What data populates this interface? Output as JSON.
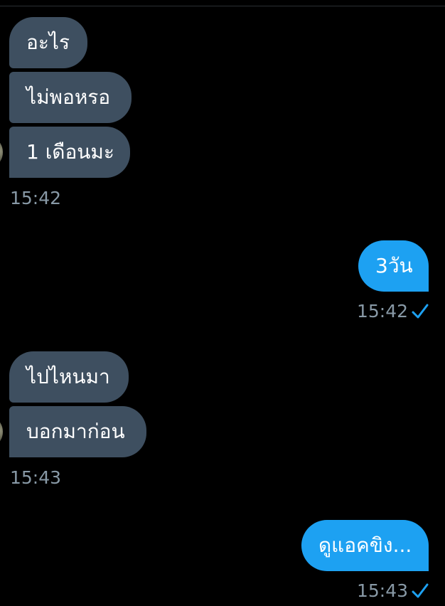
{
  "colors": {
    "background": "#000000",
    "incoming_bubble": "#3e4f60",
    "outgoing_bubble": "#1da1f2",
    "timestamp": "#8899a6",
    "read_check": "#1da1f2"
  },
  "conversation": [
    {
      "direction": "incoming",
      "messages": [
        "อะไร",
        "ไม่พอหรอ",
        "1 เดือนมะ"
      ],
      "time": "15:42"
    },
    {
      "direction": "outgoing",
      "messages": [
        "3วัน"
      ],
      "time": "15:42",
      "status_icon": "check-icon"
    },
    {
      "direction": "incoming",
      "messages": [
        "ไปไหนมา",
        "บอกมาก่อน"
      ],
      "time": "15:43"
    },
    {
      "direction": "outgoing",
      "messages": [
        "ดูแอคขิง..."
      ],
      "time": "15:43",
      "status_icon": "check-icon"
    }
  ]
}
